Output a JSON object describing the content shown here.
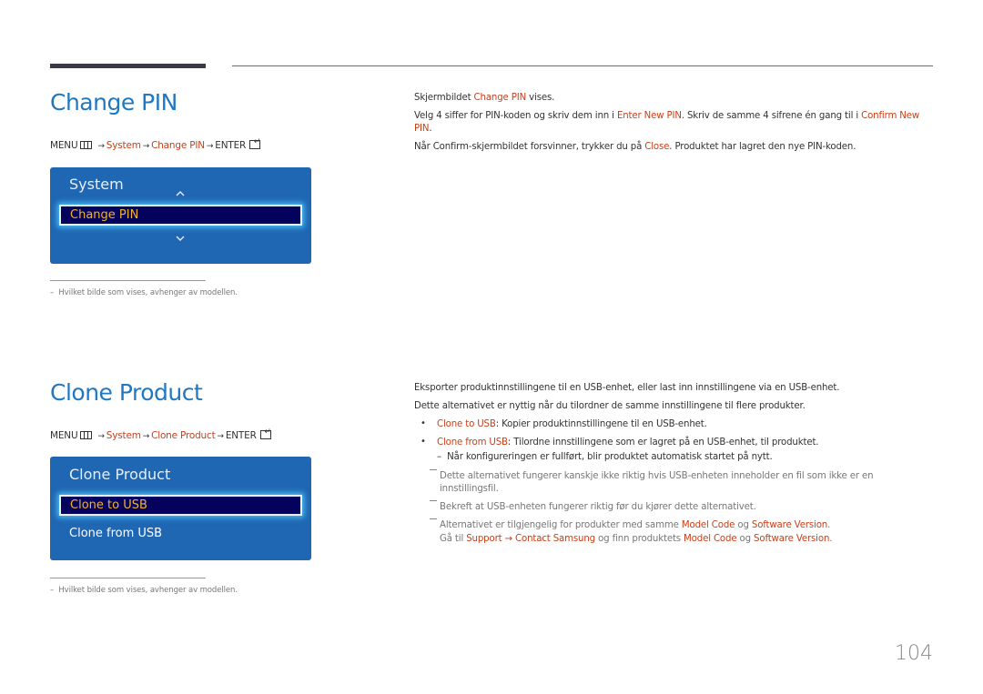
{
  "page_number": "104",
  "footnote": "Hvilket bilde som vises, avhenger av modellen.",
  "sections": {
    "change_pin": {
      "title": "Change PIN",
      "path": {
        "menu": "MENU",
        "system": "System",
        "item": "Change PIN",
        "enter": "ENTER"
      },
      "osd": {
        "title": "System",
        "selected": "Change PIN"
      },
      "desc": {
        "p1_a": "Skjermbildet ",
        "p1_hl": "Change PIN",
        "p1_b": " vises.",
        "p2_a": "Velg 4 siffer for PIN-koden og skriv dem inn i ",
        "p2_hl1": "Enter New PIN",
        "p2_b": ". Skriv de samme 4 sifrene én gang til i ",
        "p2_hl2a": "Confirm New",
        "p2_hl2b": "PIN",
        "p2_c": ".",
        "p3_a": "Når Confirm-skjermbildet forsvinner, trykker du på ",
        "p3_hl": "Close",
        "p3_b": ". Produktet har lagret den nye PIN-koden."
      }
    },
    "clone_product": {
      "title": "Clone Product",
      "path": {
        "menu": "MENU",
        "system": "System",
        "item": "Clone Product",
        "enter": "ENTER"
      },
      "osd": {
        "title": "Clone Product",
        "selected": "Clone to USB",
        "other": "Clone from USB"
      },
      "desc": {
        "p1": "Eksporter produktinnstillingene til en USB-enhet, eller last inn innstillingene via en USB-enhet.",
        "p2": "Dette alternativet er nyttig når du tilordner de samme innstillingene til flere produkter.",
        "b1_hl": "Clone to USB",
        "b1": ": Kopier produktinnstillingene til en USB-enhet.",
        "b2_hl": "Clone from USB",
        "b2": ": Tilordne innstillingene som er lagret på en USB-enhet, til produktet.",
        "b2_sub": "Når konfigureringen er fullført, blir produktet automatisk startet på nytt.",
        "n1_a": "Dette alternativet fungerer kanskje ikke riktig hvis USB-enheten inneholder en fil som ikke er en",
        "n1_b": "innstillingsfil.",
        "n2": "Bekreft at USB-enheten fungerer riktig før du kjører dette alternativet.",
        "n3_a": "Alternativet er tilgjengelig for produkter med samme ",
        "n3_hl1": "Model Code",
        "n3_og": " og ",
        "n3_hl2": "Software Version",
        "n3_dot": ".",
        "n4_a": "Gå til ",
        "n4_hl1": "Support",
        "n4_arrow": " → ",
        "n4_hl2": "Contact Samsung",
        "n4_b": " og finn produktets ",
        "n4_hl3": "Model Code",
        "n4_og": " og ",
        "n4_hl4": "Software Version",
        "n4_dot": "."
      }
    }
  },
  "colors": {
    "heading": "#1f78c1",
    "highlight": "#c8401a",
    "osd_bg": "#1f66b3",
    "osd_selected_bg": "#05025e",
    "osd_selected_text": "#f2b32d"
  }
}
